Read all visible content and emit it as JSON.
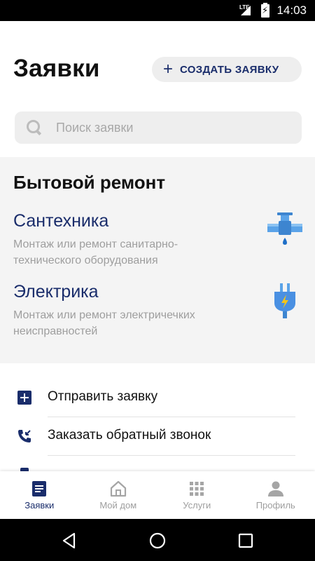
{
  "status_bar": {
    "network": "LTE",
    "time": "14:03"
  },
  "header": {
    "title": "Заявки",
    "create_button": {
      "icon": "plus-icon",
      "label": "СОЗДАТЬ ЗАЯВКУ"
    }
  },
  "search": {
    "placeholder": "Поиск заявки",
    "value": ""
  },
  "category": {
    "title": "Бытовой ремонт",
    "services": [
      {
        "title": "Сантехника",
        "description": "Монтаж или ремонт санитарно-технического оборудования",
        "icon": "plumbing-pipe-icon"
      },
      {
        "title": "Электрика",
        "description": "Монтаж или ремонт электричечких неисправностей",
        "icon": "electric-plug-icon"
      }
    ]
  },
  "actions": [
    {
      "label": "Отправить заявку",
      "icon": "plus-square-icon"
    },
    {
      "label": "Заказать обратный звонок",
      "icon": "phone-callback-icon"
    }
  ],
  "bottom_nav": {
    "items": [
      {
        "label": "Заявки",
        "icon": "requests-icon",
        "active": true
      },
      {
        "label": "Мой дом",
        "icon": "home-icon",
        "active": false
      },
      {
        "label": "Услуги",
        "icon": "grid-icon",
        "active": false
      },
      {
        "label": "Профиль",
        "icon": "person-icon",
        "active": false
      }
    ]
  },
  "colors": {
    "accent": "#1a2d6b",
    "muted": "#9e9e9e",
    "surface": "#f4f4f4",
    "pill": "#eeeeee",
    "icon_blue": "#4a90e2",
    "icon_yellow": "#f5c518"
  }
}
